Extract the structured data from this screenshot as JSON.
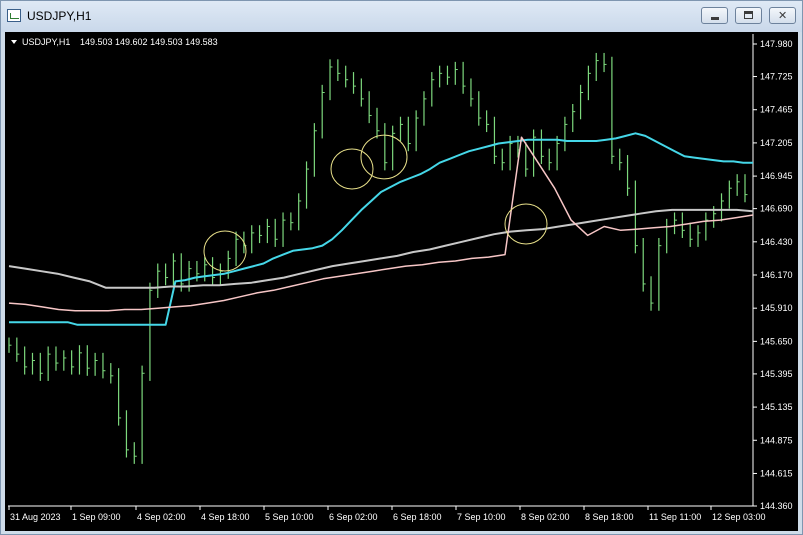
{
  "window": {
    "title": "USDJPY,H1"
  },
  "chart_data": {
    "type": "line",
    "symbol_label": "USDJPY,H1",
    "ohlc_label": "149.503 149.602 149.503 149.583",
    "ylim": [
      144.36,
      148.05
    ],
    "y_ticks": [
      "147.980",
      "147.725",
      "147.465",
      "147.205",
      "146.945",
      "146.690",
      "146.430",
      "146.170",
      "145.910",
      "145.650",
      "145.395",
      "145.135",
      "144.875",
      "144.615",
      "144.360"
    ],
    "x_ticks": [
      "31 Aug 2023",
      "1 Sep 09:00",
      "4 Sep 02:00",
      "4 Sep 18:00",
      "5 Sep 10:00",
      "6 Sep 02:00",
      "6 Sep 18:00",
      "7 Sep 10:00",
      "8 Sep 02:00",
      "8 Sep 18:00",
      "11 Sep 11:00",
      "12 Sep 03:00"
    ],
    "colors": {
      "background": "#000000",
      "price": "#7dd87d",
      "vwap_cyan": "#45d7e8",
      "line_silver": "#c8c8c8",
      "line_pink": "#f7c6c6",
      "marker": "#e8e08a",
      "text": "#ffffff"
    },
    "series": [
      {
        "color": "#7dd87d",
        "values": [
          145.62,
          145.55,
          145.45,
          145.5,
          145.4,
          145.55,
          145.48,
          145.52,
          145.45,
          145.56,
          145.44,
          145.5,
          145.42,
          145.38,
          145.05,
          144.8,
          144.75,
          145.4,
          146.05,
          146.2,
          146.15,
          146.28,
          146.1,
          146.22,
          146.18,
          146.25,
          146.15,
          146.2,
          146.3,
          146.45,
          146.4,
          146.5,
          146.48,
          146.55,
          146.45,
          146.6,
          146.58,
          146.75,
          147.0,
          147.3,
          147.6,
          147.8,
          147.75,
          147.7,
          147.65,
          147.55,
          147.42,
          147.3,
          147.05,
          147.28,
          147.35,
          147.2,
          147.4,
          147.55,
          147.7,
          147.75,
          147.72,
          147.78,
          147.65,
          147.55,
          147.4,
          147.35,
          147.1,
          147.05,
          147.2,
          147.15,
          147.0,
          147.25,
          147.1,
          147.05,
          147.2,
          147.35,
          147.45,
          147.6,
          147.75,
          147.85,
          147.82,
          147.1,
          147.05,
          146.85,
          146.4,
          146.1,
          145.95,
          146.4,
          146.55,
          146.6,
          146.52,
          146.45,
          146.5,
          146.6,
          146.65,
          146.75,
          146.85,
          146.9,
          146.8
        ]
      },
      {
        "color": "#45d7e8",
        "values": [
          145.8,
          145.8,
          145.8,
          145.8,
          145.8,
          145.8,
          145.8,
          145.78,
          145.78,
          145.78,
          145.78,
          145.78,
          145.78,
          145.78,
          145.78,
          145.78,
          145.78,
          146.12,
          146.13,
          146.15,
          146.16,
          146.17,
          146.18,
          146.2,
          146.22,
          146.24,
          146.26,
          146.3,
          146.33,
          146.36,
          146.37,
          146.38,
          146.4,
          146.45,
          146.52,
          146.6,
          146.68,
          146.75,
          146.82,
          146.86,
          146.9,
          146.93,
          146.96,
          147.0,
          147.05,
          147.08,
          147.11,
          147.14,
          147.16,
          147.18,
          147.2,
          147.21,
          147.22,
          147.23,
          147.23,
          147.23,
          147.23,
          147.22,
          147.22,
          147.22,
          147.22,
          147.23,
          147.24,
          147.26,
          147.28,
          147.26,
          147.22,
          147.18,
          147.14,
          147.1,
          147.09,
          147.08,
          147.07,
          147.06,
          147.06,
          147.05,
          147.05
        ]
      },
      {
        "color": "#c8c8c8",
        "values": [
          146.24,
          146.22,
          146.2,
          146.18,
          146.15,
          146.12,
          146.07,
          146.07,
          146.07,
          146.07,
          146.08,
          146.08,
          146.09,
          146.09,
          146.1,
          146.11,
          146.13,
          146.15,
          146.18,
          146.21,
          146.24,
          146.26,
          146.28,
          146.3,
          146.32,
          146.35,
          146.37,
          146.4,
          146.43,
          146.46,
          146.49,
          146.51,
          146.52,
          146.53,
          146.55,
          146.57,
          146.59,
          146.61,
          146.63,
          146.65,
          146.67,
          146.68,
          146.68,
          146.68,
          146.68,
          146.68,
          146.67
        ]
      },
      {
        "color": "#f7c6c6",
        "values": [
          145.95,
          145.94,
          145.92,
          145.9,
          145.89,
          145.89,
          145.89,
          145.9,
          145.9,
          145.91,
          145.92,
          145.93,
          145.95,
          145.97,
          146.0,
          146.03,
          146.05,
          146.08,
          146.11,
          146.14,
          146.16,
          146.18,
          146.2,
          146.22,
          146.24,
          146.25,
          146.27,
          146.28,
          146.3,
          146.31,
          146.33,
          147.25,
          147.05,
          146.85,
          146.6,
          146.48,
          146.55,
          146.52,
          146.53,
          146.54,
          146.55,
          146.57,
          146.59,
          146.6,
          146.62,
          146.64
        ]
      }
    ],
    "annotations": [
      "circle",
      "circle",
      "circle",
      "circle"
    ]
  }
}
